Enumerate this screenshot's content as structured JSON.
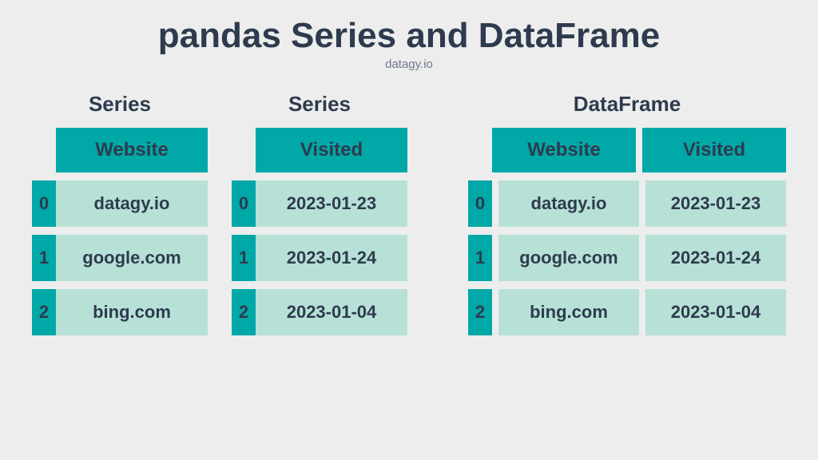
{
  "title": "pandas Series and DataFrame",
  "subtitle": "datagy.io",
  "labels": {
    "series": "Series",
    "dataframe": "DataFrame"
  },
  "series1": {
    "header": "Website",
    "rows": [
      {
        "idx": "0",
        "val": "datagy.io"
      },
      {
        "idx": "1",
        "val": "google.com"
      },
      {
        "idx": "2",
        "val": "bing.com"
      }
    ]
  },
  "series2": {
    "header": "Visited",
    "rows": [
      {
        "idx": "0",
        "val": "2023-01-23"
      },
      {
        "idx": "1",
        "val": "2023-01-24"
      },
      {
        "idx": "2",
        "val": "2023-01-04"
      }
    ]
  },
  "dataframe": {
    "headers": [
      "Website",
      "Visited"
    ],
    "rows": [
      {
        "idx": "0",
        "vals": [
          "datagy.io",
          "2023-01-23"
        ]
      },
      {
        "idx": "1",
        "vals": [
          "google.com",
          "2023-01-24"
        ]
      },
      {
        "idx": "2",
        "vals": [
          "bing.com",
          "2023-01-04"
        ]
      }
    ]
  }
}
